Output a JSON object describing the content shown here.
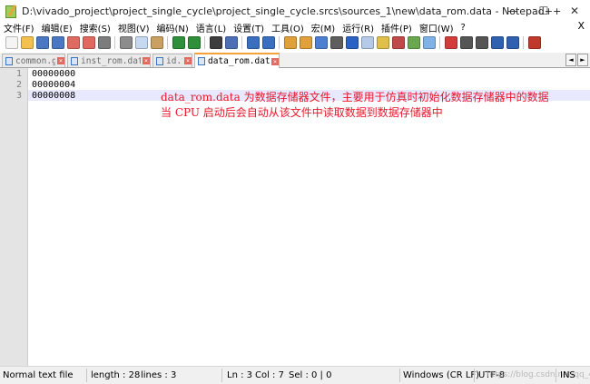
{
  "window": {
    "title": "D:\\vivado_project\\project_single_cycle\\project_single_cycle.srcs\\sources_1\\new\\data_rom.data - Notepad++",
    "controls": {
      "minimize": "—",
      "maximize": "☐",
      "close": "✕"
    }
  },
  "menu": {
    "items": [
      "文件(F)",
      "编辑(E)",
      "搜索(S)",
      "视图(V)",
      "编码(N)",
      "语言(L)",
      "设置(T)",
      "工具(O)",
      "宏(M)",
      "运行(R)",
      "插件(P)",
      "窗口(W)",
      "?"
    ],
    "close": "X"
  },
  "toolbar": {
    "buttons": [
      {
        "name": "new-file-icon",
        "color": "#f4f4f4"
      },
      {
        "name": "open-file-icon",
        "color": "#f2c14e"
      },
      {
        "name": "save-icon",
        "color": "#4a78c2"
      },
      {
        "name": "save-all-icon",
        "color": "#4a78c2"
      },
      {
        "name": "close-icon",
        "color": "#e06a5f"
      },
      {
        "name": "close-all-icon",
        "color": "#e06a5f"
      },
      {
        "name": "print-icon",
        "color": "#7c7c7c"
      },
      {
        "sep": true
      },
      {
        "name": "cut-icon",
        "color": "#8c8c8c"
      },
      {
        "name": "copy-icon",
        "color": "#c6d9f1"
      },
      {
        "name": "paste-icon",
        "color": "#c9a061"
      },
      {
        "sep": true
      },
      {
        "name": "undo-icon",
        "color": "#2f8f3a"
      },
      {
        "name": "redo-icon",
        "color": "#2f8f3a"
      },
      {
        "sep": true
      },
      {
        "name": "find-icon",
        "color": "#3d3d3d"
      },
      {
        "name": "replace-icon",
        "color": "#4d6fb6"
      },
      {
        "sep": true
      },
      {
        "name": "zoom-in-icon",
        "color": "#3a6fbf"
      },
      {
        "name": "zoom-out-icon",
        "color": "#3a6fbf"
      },
      {
        "sep": true
      },
      {
        "name": "sync-vertical-icon",
        "color": "#e0a03a"
      },
      {
        "name": "sync-horizontal-icon",
        "color": "#e0a03a"
      },
      {
        "name": "word-wrap-icon",
        "color": "#4d7fd0"
      },
      {
        "name": "show-all-chars-icon",
        "color": "#5e5e5e"
      },
      {
        "name": "indent-guide-icon",
        "color": "#2b62c4"
      },
      {
        "name": "language-icon",
        "color": "#b6c9e8"
      },
      {
        "name": "doc-map-icon",
        "color": "#e0c04a"
      },
      {
        "name": "function-list-icon",
        "color": "#c04a4a"
      },
      {
        "name": "folder-workspace-icon",
        "color": "#6aa84f"
      },
      {
        "name": "monitoring-icon",
        "color": "#7fb3e6"
      },
      {
        "sep": true
      },
      {
        "name": "record-macro-icon",
        "color": "#d43c3c"
      },
      {
        "name": "stop-macro-icon",
        "color": "#555555"
      },
      {
        "name": "play-macro-icon",
        "color": "#555555"
      },
      {
        "name": "run-macro-multiple-icon",
        "color": "#3060b0"
      },
      {
        "name": "save-macro-icon",
        "color": "#3060b0"
      },
      {
        "sep": true
      },
      {
        "name": "spell-check-icon",
        "color": "#c0392b"
      }
    ]
  },
  "tabs": [
    {
      "label": "common.go",
      "active": false
    },
    {
      "label": "inst_rom.data",
      "active": false
    },
    {
      "label": "id.v",
      "active": false
    },
    {
      "label": "data_rom.data",
      "active": true
    }
  ],
  "tab_scroll": {
    "left": "◄",
    "right": "►"
  },
  "editor": {
    "line_numbers": [
      "1",
      "2",
      "3"
    ],
    "lines": [
      "00000000",
      "00000004",
      "00000008"
    ],
    "caret_line": 3,
    "note_lines": [
      "data_rom.data 为数据存储器文件，主要用于仿真时初始化数据存储器中的数据",
      "当 CPU 启动后会自动从该文件中读取数据到数据存储器中"
    ],
    "note_color": "#e8172b"
  },
  "status": {
    "file_type": "Normal text file",
    "length": "length : 28",
    "lines": "lines : 3",
    "position": "Ln : 3",
    "column": "Col : 7",
    "selection": "Sel : 0 | 0",
    "eol": "Windows (CR LF)",
    "encoding": "UTF-8",
    "mode": "INS",
    "watermark": "https://blog.csdn.net/qq_40..."
  }
}
